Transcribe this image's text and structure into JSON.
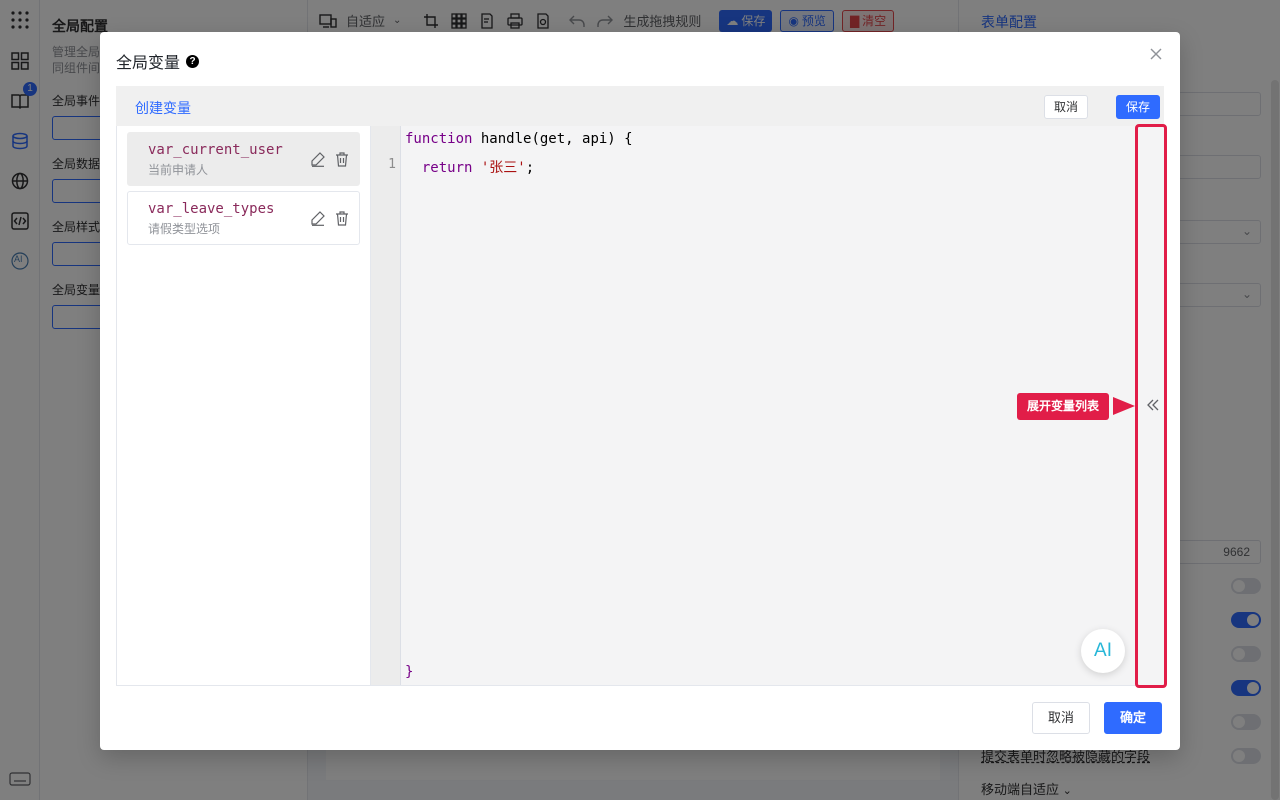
{
  "background": {
    "left_panel": {
      "title": "全局配置",
      "desc": "管理全局\n同组件间",
      "sections": [
        "全局事件",
        "全局数据",
        "全局样式",
        "全局变量"
      ]
    },
    "rail": {
      "badge": "1",
      "ai_label": "AI"
    },
    "toolbar": {
      "layout_mode": "自适应",
      "drag_rules": "生成拖拽规则",
      "save": "保存",
      "preview": "预览",
      "clear": "清空"
    },
    "right_panel": {
      "title": "表单配置",
      "field_value": "9662",
      "ignore_hidden": "提交表单时忽略被隐藏的字段",
      "mobile_adapt": "移动端自适应"
    }
  },
  "dialog": {
    "title": "全局变量",
    "help": "?",
    "header": {
      "create_var": "创建变量",
      "cancel": "取消",
      "save": "保存"
    },
    "variables": [
      {
        "name": "var_current_user",
        "desc": "当前申请人",
        "active": true
      },
      {
        "name": "var_leave_types",
        "desc": "请假类型选项",
        "active": false
      }
    ],
    "editor": {
      "line_number": "1",
      "code": {
        "kw_function": "function",
        "fn_sig": " handle(get, api) {",
        "kw_return": "return",
        "str_value": "'张三'",
        "semicolon": ";",
        "close_brace": "}"
      }
    },
    "callout": "展开变量列表",
    "ai_fab": "AI",
    "footer": {
      "cancel": "取消",
      "confirm": "确定"
    }
  }
}
